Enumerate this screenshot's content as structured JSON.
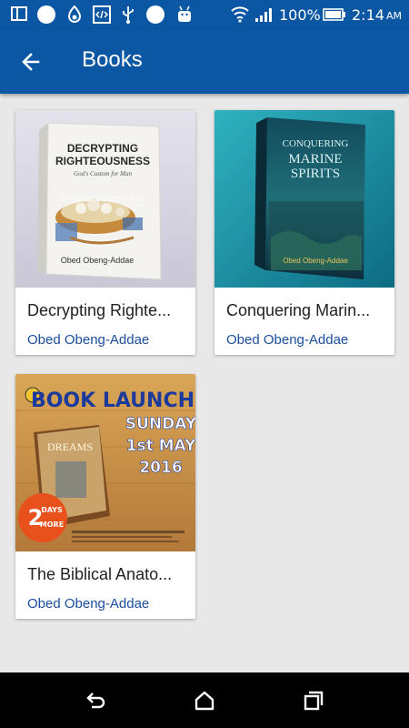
{
  "status_bar": {
    "battery_percent": "100%",
    "time": "2:14",
    "ampm": "AM",
    "icons": [
      "screen-icon",
      "circle-icon",
      "fire-icon",
      "code-icon",
      "usb-icon",
      "circle-icon",
      "android-icon",
      "wifi-icon",
      "signal-icon",
      "battery-icon"
    ]
  },
  "app_bar": {
    "title": "Books",
    "back_icon": "arrow-left-icon"
  },
  "books": [
    {
      "title": "Decrypting Righte...",
      "author": "Obed Obeng-Addae",
      "cover": {
        "heading": "DECRYPTING RIGHTEOUSNESS",
        "subheading": "God's Custom for Man",
        "watermark": "CHRISTOS MATHETUAN INC",
        "author": "Obed Obeng-Addae"
      }
    },
    {
      "title": "Conquering Marin...",
      "author": "Obed Obeng-Addae",
      "cover": {
        "heading": "CONQUERING MARINE SPIRITS",
        "author": "Obed Obeng-Addae"
      }
    },
    {
      "title": "The Biblical Anato...",
      "author": "Obed Obeng-Addae",
      "cover": {
        "headline": "BOOK LAUNCH!",
        "day": "SUNDAY",
        "date": "1st MAY",
        "year": "2016",
        "book": "DREAMS",
        "badge_num": "2",
        "badge_top": "DAYS",
        "badge_bottom": "MORE"
      }
    }
  ],
  "nav": {
    "back": "back-icon",
    "home": "home-icon",
    "recents": "recents-icon"
  }
}
